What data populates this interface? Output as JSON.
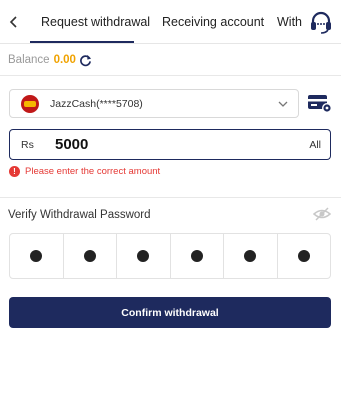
{
  "tabs": [
    {
      "label": "Request withdrawal"
    },
    {
      "label": "Receiving account"
    },
    {
      "label": "With"
    }
  ],
  "balance": {
    "label": "Balance",
    "value": "0.00"
  },
  "account": {
    "name": "JazzCash(****5708)"
  },
  "amount": {
    "currency": "Rs",
    "value": "5000",
    "all_label": "All"
  },
  "error": {
    "message": "Please enter the correct amount"
  },
  "password": {
    "label": "Verify Withdrawal Password",
    "digits_entered": 6
  },
  "confirm": {
    "label": "Confirm withdrawal"
  },
  "colors": {
    "primary": "#1e2a5e",
    "balance": "#f0a200",
    "error": "#e53935"
  }
}
